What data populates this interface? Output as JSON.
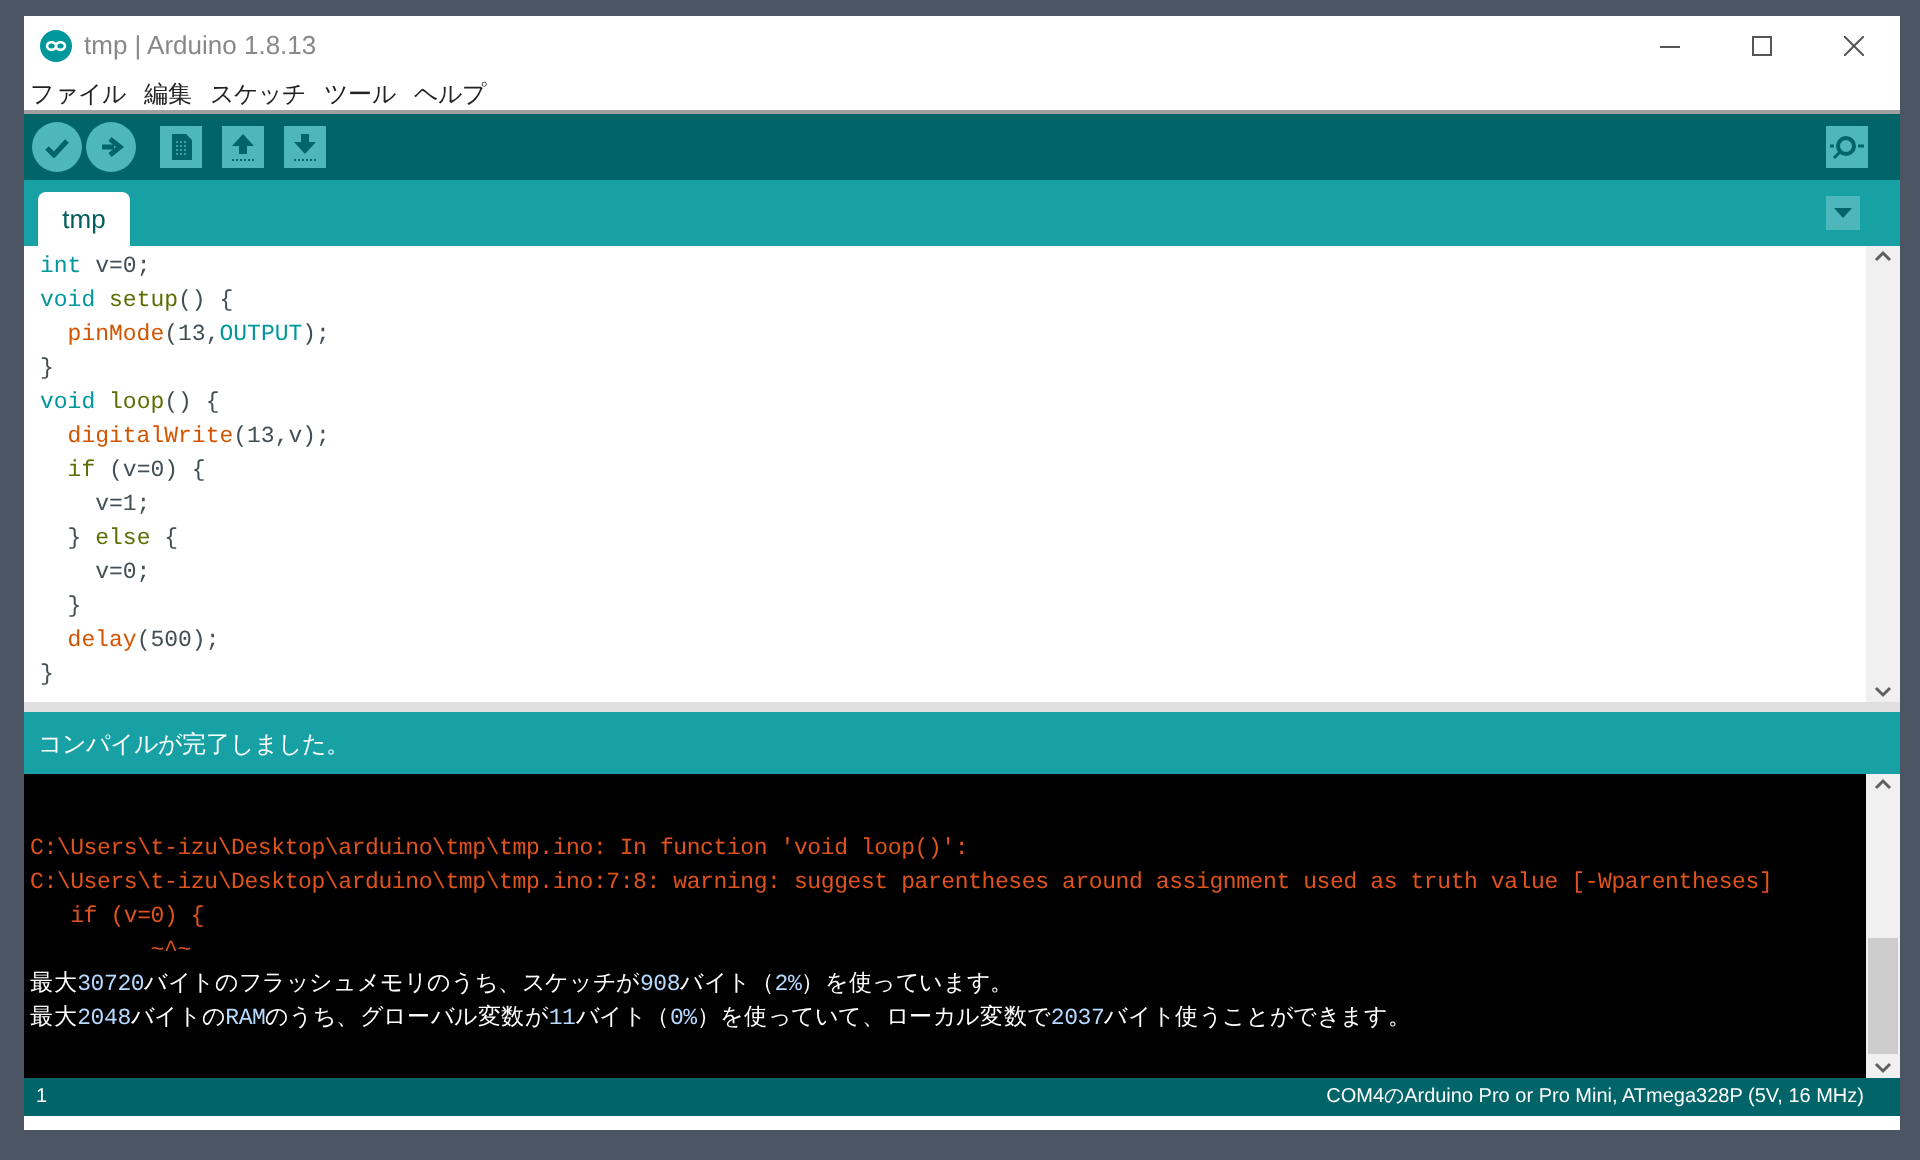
{
  "window": {
    "title": "tmp | Arduino 1.8.13"
  },
  "menu": [
    "ファイル",
    "編集",
    "スケッチ",
    "ツール",
    "ヘルプ"
  ],
  "tabs": [
    {
      "label": "tmp",
      "selected": true
    }
  ],
  "editor": {
    "lines": [
      [
        {
          "kind": "type",
          "text": "int"
        },
        {
          "kind": "plain",
          "text": " v=0;"
        }
      ],
      [
        {
          "kind": "type",
          "text": "void"
        },
        {
          "kind": "struct",
          "text": " setup"
        },
        {
          "kind": "plain",
          "text": "() {"
        }
      ],
      [
        {
          "kind": "func",
          "text": "  pinMode"
        },
        {
          "kind": "plain",
          "text": "(13,"
        },
        {
          "kind": "type",
          "text": "OUTPUT"
        },
        {
          "kind": "plain",
          "text": ");"
        }
      ],
      [
        {
          "kind": "plain",
          "text": "}"
        }
      ],
      [
        {
          "kind": "type",
          "text": "void"
        },
        {
          "kind": "struct",
          "text": " loop"
        },
        {
          "kind": "plain",
          "text": "() {"
        }
      ],
      [
        {
          "kind": "func",
          "text": "  digitalWrite"
        },
        {
          "kind": "plain",
          "text": "(13,v);"
        }
      ],
      [
        {
          "kind": "struct",
          "text": "  if"
        },
        {
          "kind": "plain",
          "text": " (v=0) {"
        }
      ],
      [
        {
          "kind": "plain",
          "text": "    v=1;"
        }
      ],
      [
        {
          "kind": "plain",
          "text": "  } "
        },
        {
          "kind": "struct",
          "text": "else"
        },
        {
          "kind": "plain",
          "text": " {"
        }
      ],
      [
        {
          "kind": "plain",
          "text": "    v=0;"
        }
      ],
      [
        {
          "kind": "plain",
          "text": "  }"
        }
      ],
      [
        {
          "kind": "func",
          "text": "  delay"
        },
        {
          "kind": "plain",
          "text": "(500);"
        }
      ],
      [
        {
          "kind": "plain",
          "text": "}"
        }
      ]
    ]
  },
  "status": {
    "message": "コンパイルが完了しました。"
  },
  "console": {
    "lines": [
      {
        "kind": "error",
        "parts": [
          {
            "kind": "text",
            "text": "C:\\Users\\t-izu\\Desktop\\arduino\\tmp\\tmp.ino: In function 'void loop()':"
          }
        ]
      },
      {
        "kind": "error",
        "parts": [
          {
            "kind": "text",
            "text": "C:\\Users\\t-izu\\Desktop\\arduino\\tmp\\tmp.ino:7:8: warning: suggest parentheses around assignment used as truth value [-Wparentheses]"
          }
        ]
      },
      {
        "kind": "error",
        "parts": [
          {
            "kind": "text",
            "text": "   if (v=0) {"
          }
        ]
      },
      {
        "kind": "error",
        "parts": [
          {
            "kind": "text",
            "text": "         ~^~"
          }
        ]
      },
      {
        "kind": "info",
        "parts": [
          {
            "kind": "text",
            "text": "最大"
          },
          {
            "kind": "num",
            "text": "30720"
          },
          {
            "kind": "text",
            "text": "バイトのフラッシュメモリのうち、スケッチが"
          },
          {
            "kind": "num",
            "text": "908"
          },
          {
            "kind": "text",
            "text": "バイト（"
          },
          {
            "kind": "num",
            "text": "2%"
          },
          {
            "kind": "text",
            "text": "）を使っています。"
          }
        ]
      },
      {
        "kind": "info",
        "parts": [
          {
            "kind": "text",
            "text": "最大"
          },
          {
            "kind": "num",
            "text": "2048"
          },
          {
            "kind": "text",
            "text": "バイトの"
          },
          {
            "kind": "num",
            "text": "RAM"
          },
          {
            "kind": "text",
            "text": "のうち、グローバル変数が"
          },
          {
            "kind": "num",
            "text": "11"
          },
          {
            "kind": "text",
            "text": "バイト（"
          },
          {
            "kind": "num",
            "text": "0%"
          },
          {
            "kind": "text",
            "text": "）を使っていて、ローカル変数で"
          },
          {
            "kind": "num",
            "text": "2037"
          },
          {
            "kind": "text",
            "text": "バイト使うことができます。"
          }
        ]
      }
    ]
  },
  "status_bar": {
    "line": "1",
    "board": "COM4のArduino Pro or Pro Mini, ATmega328P (5V, 16 MHz)"
  }
}
